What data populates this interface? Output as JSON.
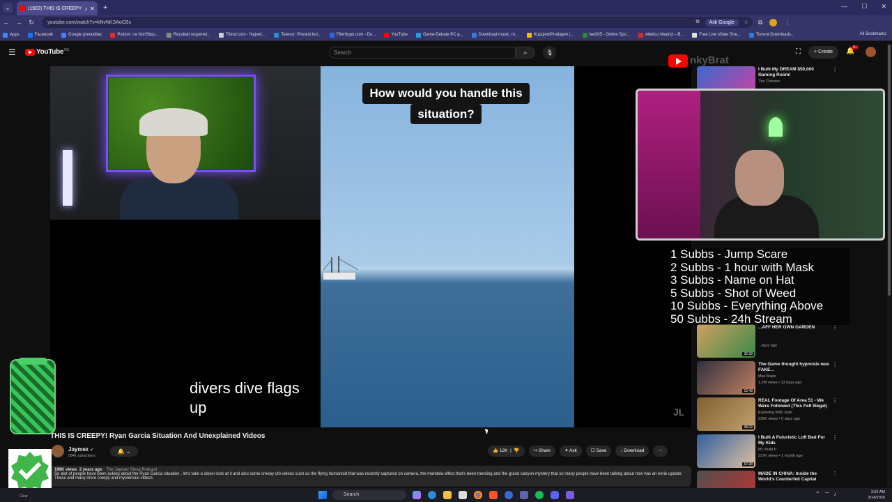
{
  "browser": {
    "tab_title": "(1922) THIS IS CREEPY! Rya",
    "url": "youtube.com/watch?v=kNvNKSAoCBs",
    "ask_google": "Ask Google",
    "bookmarks": [
      {
        "label": "Apps",
        "color": "#4285f4"
      },
      {
        "label": "Facebook",
        "color": "#1877f2"
      },
      {
        "label": "Google prevodilac",
        "color": "#4285f4"
      },
      {
        "label": "Poklon: na NonStop...",
        "color": "#e03030"
      },
      {
        "label": "Rezultati nogomet...",
        "color": "#888888"
      },
      {
        "label": "Titlovi.com - Najveć...",
        "color": "#cccccc"
      },
      {
        "label": "Telenor: Privatni kor...",
        "color": "#2a8adc"
      },
      {
        "label": "FileHippo.com - Do...",
        "color": "#2a6adc"
      },
      {
        "label": "YouTube",
        "color": "#ff0000"
      },
      {
        "label": "Game-Debate PC g...",
        "color": "#2a9adc"
      },
      {
        "label": "Download music, m...",
        "color": "#3a7adc"
      },
      {
        "label": "KupujemProdajem |...",
        "color": "#f0c000"
      },
      {
        "label": "bet365 - Online Spo...",
        "color": "#2a8a3a"
      },
      {
        "label": "Atletico Madrid – B...",
        "color": "#d03030"
      },
      {
        "label": "Free Live Video Stre...",
        "color": "#e0e0e0"
      },
      {
        "label": "Torrent Downloads...",
        "color": "#2a7adc"
      }
    ],
    "all_bookmarks": "All Bookmarks"
  },
  "youtube": {
    "logo_text": "YouTube",
    "region": "RS",
    "search_placeholder": "Search",
    "create_label": "Create",
    "notif_count": "9+"
  },
  "player": {
    "caption_line1": "How would you handle this",
    "caption_line2": "situation?",
    "subtitle_line1": "divers dive flags",
    "subtitle_line2": "up",
    "watermark": "JL"
  },
  "overlay": {
    "channel_ghost": "nkyBrat",
    "rules": [
      "1 Subbs - Jump Scare",
      "2 Subbs - 1 hour with Mask",
      "3 Subbs - Name on Hat",
      "5 Subbs - Shot of Weed",
      "10 Subbs - Everything Above",
      "50 Subbs - 24h Stream"
    ],
    "clear_label": "Clear"
  },
  "video": {
    "title": "THIS IS CREEPY! Ryan Garcia Situation And Unexplained Videos",
    "channel": "Jaymez",
    "subscribers": "504K subscribers",
    "likes": "12K",
    "share": "Share",
    "ask": "Ask",
    "save": "Save",
    "download": "Download",
    "views": "199K views",
    "age": "2 years ago",
    "podcast": "The Jaymez Show Podcast",
    "description": "So alot of people have been asking about the Ryan Garcia situation , let's take a closer look at it and also some creepy ufo videos such as the flying humanoid that was recently captured on camera, the mandela effect that's been trending and the grand canyon mystery that so many people have been talking about now has an eerie update. These and many more creepy and mysterious videos"
  },
  "recommendations": [
    {
      "title": "I Built My DREAM $50,000 Gaming Room!",
      "channel": "The Chinsler",
      "meta": "",
      "duration": "",
      "colors": [
        "#3a6ad0",
        "#d040a0"
      ]
    },
    {
      "title": "...AFF HER OWN GARDEN",
      "channel": "",
      "meta": "...days ago",
      "duration": "32:38",
      "colors": [
        "#d0a060",
        "#3a8a4a"
      ]
    },
    {
      "title": "The Game thought hypnosis was FAKE...",
      "channel": "Max Major",
      "meta": "1.2M views • 13 days ago",
      "duration": "12:48",
      "colors": [
        "#303040",
        "#c08060"
      ]
    },
    {
      "title": "REAL Footage Of Area 51 - We Were Followed (This Felt Illegal)",
      "channel": "Exploring With Josh",
      "meta": "235K views • 5 days ago",
      "duration": "45:02",
      "colors": [
        "#806030",
        "#c0a070"
      ]
    },
    {
      "title": "I Built A Futuristic Loft Bed For My Kids",
      "channel": "Mr. Build It",
      "meta": "237K views • 1 month ago",
      "duration": "57:28",
      "colors": [
        "#3060a0",
        "#e0c0a0"
      ]
    },
    {
      "title": "MADE IN CHINA: Inside the World's Counterfeit Capital",
      "channel": "",
      "meta": "",
      "duration": "",
      "colors": [
        "#505050",
        "#c03030"
      ]
    }
  ],
  "taskbar": {
    "search_label": "Search",
    "time": "3:02 AM",
    "date": "3/14/2026"
  }
}
